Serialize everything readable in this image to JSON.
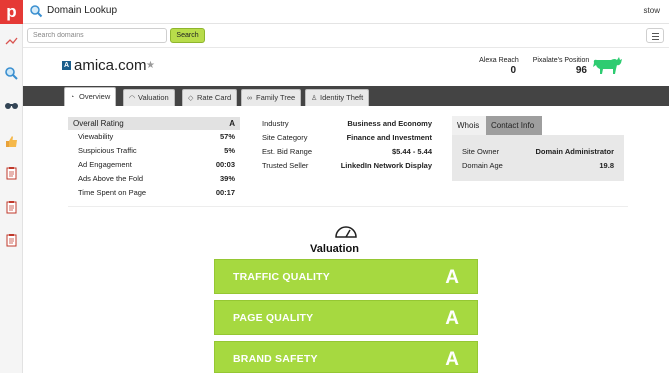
{
  "app": {
    "logo_letter": "p",
    "title": "Domain Lookup",
    "user": "stow"
  },
  "rail": {
    "icons": [
      "analytics-icon",
      "domain-search-icon",
      "binoculars-icon",
      "thumbs-up-icon",
      "report-icon",
      "report-icon",
      "report-icon"
    ]
  },
  "search": {
    "placeholder": "Search domains",
    "button_label": "Search"
  },
  "domain": {
    "name": "amica.com",
    "favicon_letter": "A",
    "alexa_label": "Alexa Reach",
    "alexa_value": "0",
    "pixalate_label": "Pixalate's Position",
    "pixalate_value": "96"
  },
  "tabs": [
    {
      "label": "Overview",
      "icon": "overview-icon",
      "active": true
    },
    {
      "label": "Valuation",
      "icon": "valuation-icon",
      "active": false
    },
    {
      "label": "Rate Card",
      "icon": "tag-icon",
      "active": false
    },
    {
      "label": "Family Tree",
      "icon": "link-icon",
      "active": false
    },
    {
      "label": "Identity Theft",
      "icon": "person-icon",
      "active": false
    }
  ],
  "stats": {
    "header_label": "Overall Rating",
    "header_value": "A",
    "rows": [
      {
        "label": "Viewability",
        "value": "57%"
      },
      {
        "label": "Suspicious Traffic",
        "value": "5%"
      },
      {
        "label": "Ad Engagement",
        "value": "00:03"
      },
      {
        "label": "Ads Above the Fold",
        "value": "39%"
      },
      {
        "label": "Time Spent on Page",
        "value": "00:17"
      }
    ]
  },
  "info": {
    "rows": [
      {
        "label": "Industry",
        "value": "Business and Economy"
      },
      {
        "label": "Site Category",
        "value": "Finance and Investment"
      },
      {
        "label": "Est. Bid Range",
        "value": "$5.44 - 5.44"
      },
      {
        "label": "Trusted Seller",
        "value": "LinkedIn Network Display"
      }
    ]
  },
  "whois": {
    "tabs": [
      "Whois",
      "Contact Info"
    ],
    "rows": [
      {
        "label": "Site Owner",
        "value": "Domain Administrator"
      },
      {
        "label": "Domain Age",
        "value": "19.8"
      }
    ]
  },
  "valuation": {
    "title": "Valuation",
    "cards": [
      {
        "label": "TRAFFIC QUALITY",
        "grade": "A"
      },
      {
        "label": "PAGE QUALITY",
        "grade": "A"
      },
      {
        "label": "BRAND SAFETY",
        "grade": "A"
      }
    ]
  },
  "colors": {
    "accent_green": "#a6d940",
    "logo_red": "#e53935",
    "tabbar": "#444444",
    "bull_green": "#2ecc71"
  }
}
